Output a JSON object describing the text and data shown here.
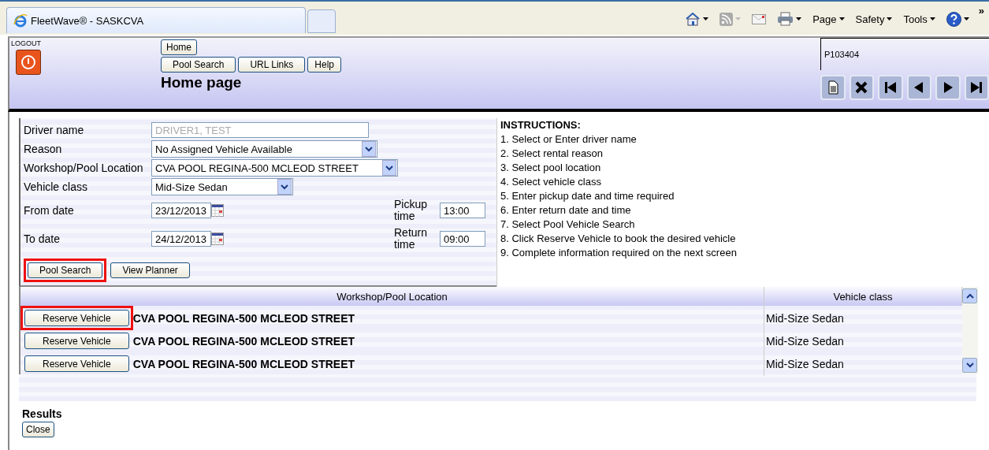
{
  "browser": {
    "tab_title": "FleetWave® - SASKCVA",
    "commands": [
      {
        "kind": "home"
      },
      {
        "kind": "feeds"
      },
      {
        "kind": "mail"
      },
      {
        "kind": "print"
      },
      {
        "kind": "menu",
        "label": "Page"
      },
      {
        "kind": "menu",
        "label": "Safety"
      },
      {
        "kind": "menu",
        "label": "Tools"
      },
      {
        "kind": "help"
      }
    ],
    "more": "»"
  },
  "header": {
    "logout_label": "LOGOUT",
    "nav_rows": [
      [
        "Home"
      ],
      [
        "Pool Search",
        "URL Links",
        "Help"
      ]
    ],
    "title": "Home page",
    "record_id": "P103404",
    "record_tools": [
      {
        "kind": "document"
      },
      {
        "kind": "delete"
      },
      {
        "kind": "first"
      },
      {
        "kind": "previous"
      },
      {
        "kind": "next"
      },
      {
        "kind": "last"
      }
    ]
  },
  "form": {
    "fields": [
      {
        "label": "Driver name",
        "kind": "text",
        "value": "DRIVER1, TEST",
        "disabled": true
      },
      {
        "label": "Reason",
        "kind": "select",
        "value": "No Assigned Vehicle Available"
      },
      {
        "label": "Workshop/Pool Location",
        "kind": "select",
        "value": "CVA POOL REGINA-500 MCLEOD STREET"
      },
      {
        "label": "Vehicle class",
        "kind": "select",
        "value": "Mid-Size Sedan"
      },
      {
        "label": "From date",
        "kind": "date",
        "value": "23/12/2013",
        "time_label": "Pickup time",
        "time_value": "13:00"
      },
      {
        "label": "To date",
        "kind": "date",
        "value": "24/12/2013",
        "time_label": "Return time",
        "time_value": "09:00"
      }
    ],
    "buttons": [
      {
        "label": "Pool Search",
        "highlighted": true
      },
      {
        "label": "View Planner",
        "highlighted": false
      }
    ]
  },
  "instructions": {
    "title": "INSTRUCTIONS:",
    "steps": [
      "1. Select or Enter driver name",
      "2. Select rental reason",
      "3. Select pool location",
      "4. Select vehicle class",
      "5. Enter pickup date and time required",
      "6. Enter return date and time",
      "7. Select Pool Vehicle Search",
      "8. Click Reserve Vehicle to book the desired vehicle",
      "9. Complete information required on the next screen"
    ]
  },
  "table": {
    "columns": [
      "Workshop/Pool Location",
      "Vehicle class"
    ],
    "rows": [
      {
        "action": "Reserve Vehicle",
        "highlighted": true,
        "location": "CVA POOL REGINA-500 MCLEOD STREET",
        "vehicle_class": "Mid-Size Sedan"
      },
      {
        "action": "Reserve Vehicle",
        "highlighted": false,
        "location": "CVA POOL REGINA-500 MCLEOD STREET",
        "vehicle_class": "Mid-Size Sedan"
      },
      {
        "action": "Reserve Vehicle",
        "highlighted": false,
        "location": "CVA POOL REGINA-500 MCLEOD STREET",
        "vehicle_class": "Mid-Size Sedan"
      }
    ]
  },
  "results": {
    "title": "Results",
    "button": "Close"
  }
}
